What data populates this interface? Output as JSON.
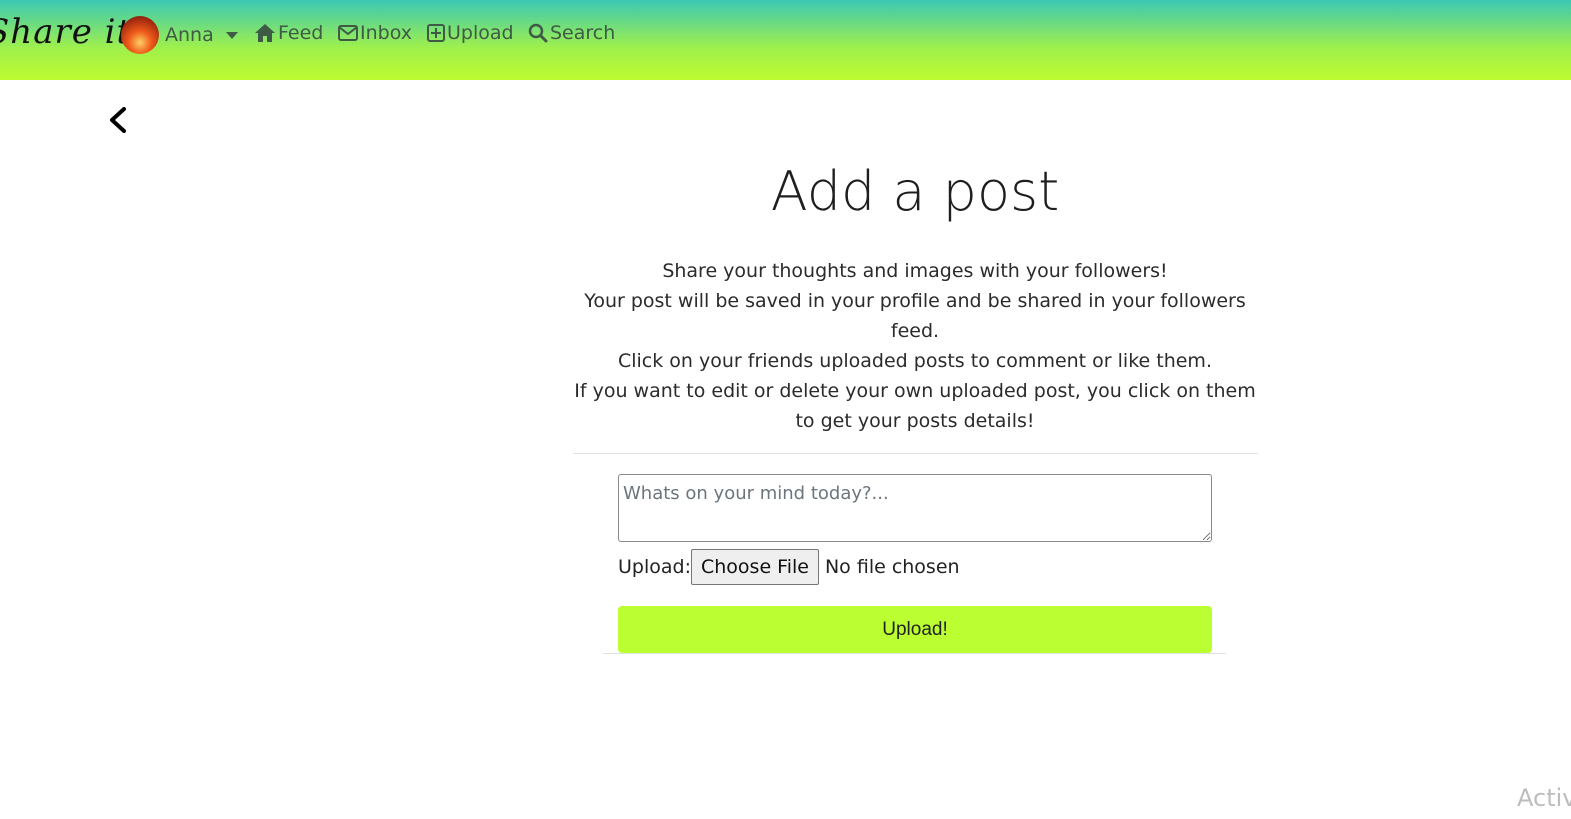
{
  "navbar": {
    "brand": "Share it",
    "user_name": "Anna",
    "links": [
      {
        "label": "Feed",
        "icon": "home-icon"
      },
      {
        "label": "Inbox",
        "icon": "envelope-icon"
      },
      {
        "label": "Upload",
        "icon": "plus-square-icon"
      },
      {
        "label": "Search",
        "icon": "search-icon"
      }
    ]
  },
  "page": {
    "title": "Add a post",
    "description": [
      "Share your thoughts and images with your followers!",
      "Your post will be saved in your profile and be shared in your followers feed.",
      "Click on your friends uploaded posts to comment or like them.",
      "If you want to edit or delete your own uploaded post, you click on them to get your posts details!"
    ]
  },
  "form": {
    "textarea_placeholder": "Whats on your mind today?...",
    "upload_label": "Upload:",
    "choose_file_label": "Choose File",
    "no_file_text": "No file chosen",
    "submit_label": "Upload!"
  },
  "watermark": "Activ",
  "colors": {
    "gradient_top": "#3cc8b4",
    "gradient_bottom": "#bdfb30",
    "submit_bg": "#bbff33",
    "nav_text": "#3f5a45"
  }
}
